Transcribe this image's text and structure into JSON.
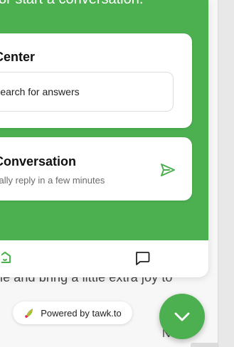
{
  "colors": {
    "brand_green": "#4caf50",
    "card_bg": "#ffffff",
    "muted_text": "#6b6b6b",
    "page_bg": "#f7f7f7"
  },
  "widget": {
    "top_text": "or start a conversation.",
    "help_center": {
      "title": "Center",
      "search_value": "Search for answers"
    },
    "conversation": {
      "title": "Conversation",
      "subtitle": "cally reply in a few minutes",
      "send_icon": "send-icon"
    },
    "nav": {
      "home_icon": "home-icon",
      "chat_icon": "chat-icon"
    }
  },
  "background_page": {
    "sentence_fragment": "le and bring a little extra joy to",
    "next_label": "Next"
  },
  "branding": {
    "powered_by": "Powered by tawk.to",
    "logo_icon": "tawkto-leaf-icon"
  },
  "fab": {
    "icon": "chevron-down-icon"
  }
}
